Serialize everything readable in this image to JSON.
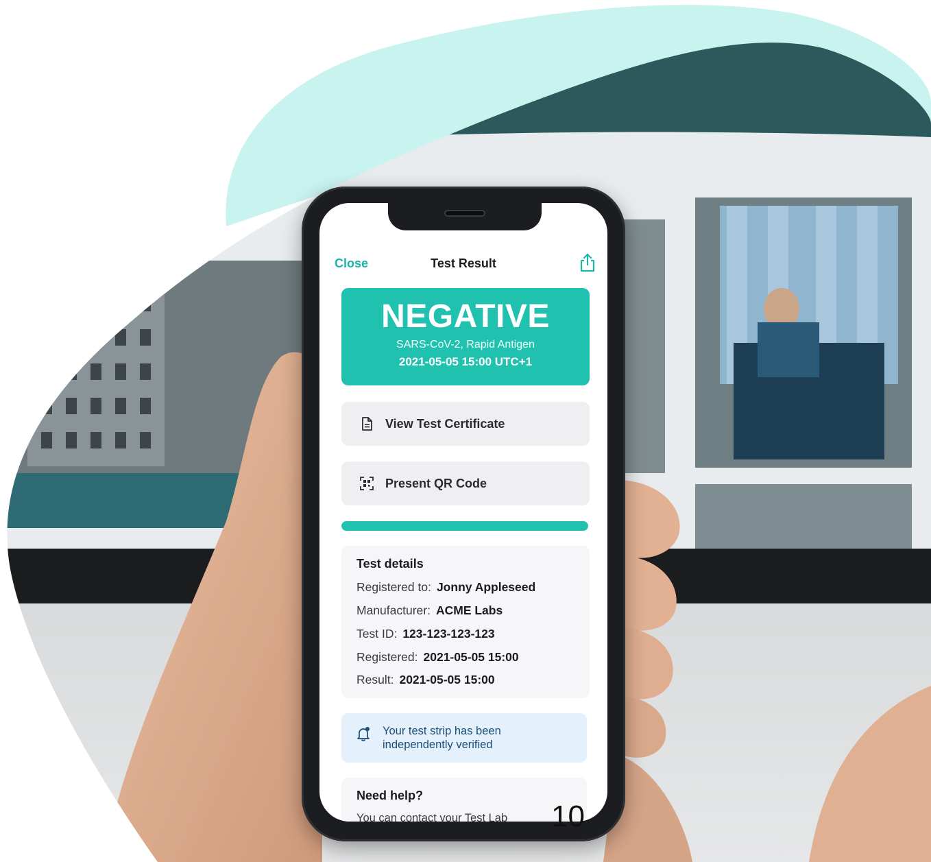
{
  "colors": {
    "accent": "#21c1b0",
    "accent_text": "#1bb6a8",
    "notice_bg": "#e4f0fb",
    "notice_text": "#1a4e78",
    "blob_mint": "#c9f3ef"
  },
  "nav": {
    "close_label": "Close",
    "title": "Test Result",
    "share_icon": "share-icon"
  },
  "result": {
    "status": "NEGATIVE",
    "test_type": "SARS-CoV-2, Rapid Antigen",
    "datetime": "2021-05-05 15:00 UTC+1"
  },
  "actions": {
    "certificate": {
      "label": "View Test Certificate",
      "icon": "document-icon"
    },
    "qr": {
      "label": "Present QR Code",
      "icon": "qr-code-icon"
    }
  },
  "progress": {
    "fraction": 1.0
  },
  "details": {
    "title": "Test details",
    "rows": [
      {
        "label": "Registered to:",
        "value": "Jonny Appleseed"
      },
      {
        "label": "Manufacturer:",
        "value": "ACME Labs"
      },
      {
        "label": "Test ID:",
        "value": "123-123-123-123"
      },
      {
        "label": "Registered:",
        "value": "2021-05-05 15:00"
      },
      {
        "label": "Result:",
        "value": "2021-05-05 15:00"
      }
    ]
  },
  "notice": {
    "icon": "bell-icon",
    "text": "Your test strip has been independently verified"
  },
  "help": {
    "title": "Need help?",
    "text": "You can contact your Test Lab"
  },
  "slide": {
    "page_number": "10"
  }
}
